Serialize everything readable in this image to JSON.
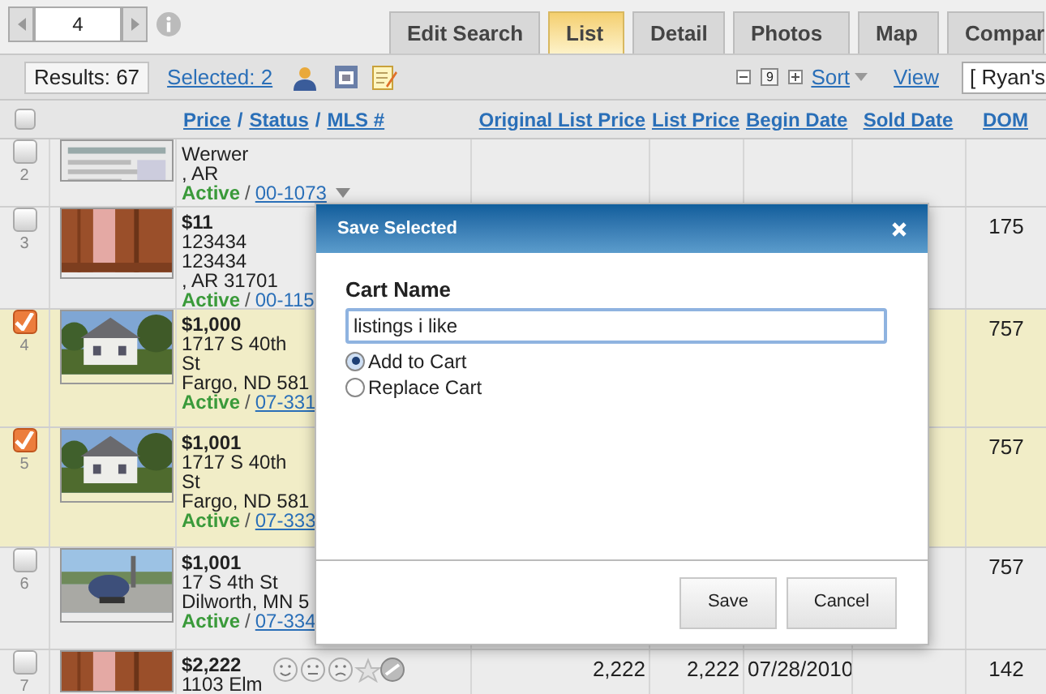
{
  "pager": {
    "page": "4"
  },
  "tabs": [
    {
      "label": "Edit Search",
      "selected": false
    },
    {
      "label": "List",
      "selected": true
    },
    {
      "label": "Detail",
      "selected": false
    },
    {
      "label": "Photos",
      "selected": false
    },
    {
      "label": "Map",
      "selected": false
    },
    {
      "label": "Compar",
      "selected": false
    }
  ],
  "toolbar": {
    "results": "Results: 67",
    "selected_link": "Selected: 2",
    "columns_count": "9",
    "sort": "Sort",
    "view": "View",
    "view_select": "[ Ryan's"
  },
  "table": {
    "all_selected": false,
    "first_header": [
      {
        "kind": "link",
        "text": "Price"
      },
      {
        "kind": "sep",
        "text": "/"
      },
      {
        "kind": "link",
        "text": "Status"
      },
      {
        "kind": "sep",
        "text": "/"
      },
      {
        "kind": "link",
        "text": "MLS #"
      }
    ],
    "columns": [
      "Original List Price",
      "List Price",
      "Begin Date",
      "Sold Date",
      "DOM"
    ],
    "rows": [
      {
        "number": "2",
        "selected": false,
        "lines": [
          "Werwer",
          ", AR"
        ],
        "status": "Active",
        "status_separator": "/",
        "mls": "00-1073",
        "menu": true,
        "tools": false,
        "cells": {}
      },
      {
        "number": "3",
        "selected": false,
        "lines": [
          "$11",
          "123434",
          "123434",
          ", AR 31701"
        ],
        "status": "Active",
        "status_separator": "/",
        "mls": "00-115",
        "menu": false,
        "tools": false,
        "cells": {
          "dom": "175"
        }
      },
      {
        "number": "4",
        "selected": true,
        "lines": [
          "$1,000",
          "1717 S 40th",
          "St",
          "Fargo, ND 581"
        ],
        "status": "Active",
        "status_separator": "/",
        "mls": "07-331",
        "menu": false,
        "tools": false,
        "cells": {
          "dom": "757"
        }
      },
      {
        "number": "5",
        "selected": true,
        "lines": [
          "$1,001",
          "1717 S 40th",
          "St",
          "Fargo, ND 581"
        ],
        "status": "Active",
        "status_separator": "/",
        "mls": "07-333",
        "menu": false,
        "tools": false,
        "cells": {
          "dom": "757"
        }
      },
      {
        "number": "6",
        "selected": false,
        "lines": [
          "$1,001",
          "17 S 4th St",
          "Dilworth, MN 5"
        ],
        "status": "Active",
        "status_separator": "/",
        "mls": "07-334",
        "menu": false,
        "tools": false,
        "cells": {
          "dom": "757"
        }
      },
      {
        "number": "7",
        "selected": false,
        "lines": [
          "$2,222",
          "1103 Elm"
        ],
        "menu": false,
        "tools": true,
        "cells": {
          "original_list_price": "2,222",
          "list_price": "2,222",
          "begin_date": "07/28/2010",
          "dom": "142"
        }
      }
    ]
  },
  "dialog": {
    "title": "Save Selected",
    "field_label": "Cart Name",
    "value": "listings i like",
    "options": [
      {
        "label": "Add to Cart",
        "selected": true
      },
      {
        "label": "Replace Cart",
        "selected": false
      }
    ],
    "buttons": [
      "Save",
      "Cancel"
    ]
  }
}
